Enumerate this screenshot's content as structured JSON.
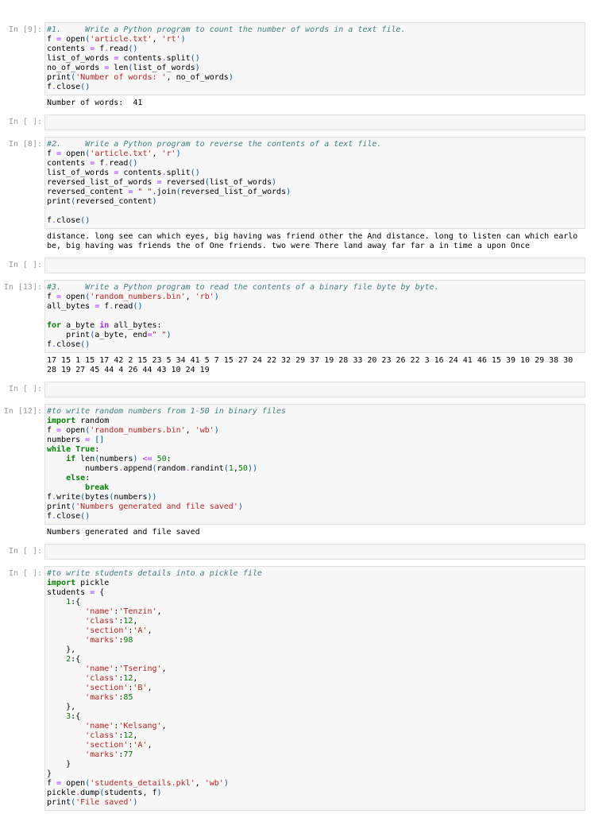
{
  "cells": [
    {
      "prompt": "In [9]:",
      "code": [
        "#1.     Write a Python program to count the number of words in a text file.",
        "f = open('article.txt', 'rt')",
        "contents = f.read()",
        "list_of_words = contents.split()",
        "no_of_words = len(list_of_words)",
        "print('Number of words: ', no_of_words)",
        "f.close()"
      ],
      "output": [
        "Number of words:  41"
      ]
    },
    {
      "prompt": "In [ ]:",
      "code": [
        ""
      ],
      "output": []
    },
    {
      "prompt": "In [8]:",
      "code": [
        "#2.     Write a Python program to reverse the contents of a text file.",
        "f = open('article.txt', 'r')",
        "contents = f.read()",
        "list_of_words = contents.split()",
        "reversed_list_of_words = reversed(list_of_words)",
        "reversed_content = \" \".join(reversed_list_of_words)",
        "print(reversed_content)",
        "",
        "f.close()"
      ],
      "output": [
        "distance. long see can which eyes, big having was friend other the And distance. long to listen can which earlo",
        "be, big having was friends the of One friends. two were There land away far far a in time a upon Once"
      ]
    },
    {
      "prompt": "In [ ]:",
      "code": [
        ""
      ],
      "output": []
    },
    {
      "prompt": "In [13]:",
      "code": [
        "#3.     Write a Python program to read the contents of a binary file byte by byte.",
        "f = open('random_numbers.bin', 'rb')",
        "all_bytes = f.read()",
        "",
        "for a_byte in all_bytes:",
        "    print(a_byte, end=\" \")",
        "f.close()"
      ],
      "output": [
        "17 15 1 15 17 42 2 15 23 5 34 41 5 7 15 27 24 22 32 29 37 19 28 33 20 23 26 22 3 16 24 41 46 15 39 10 29 38 30",
        "28 19 27 45 44 4 26 44 43 10 24 19"
      ]
    },
    {
      "prompt": "In [ ]:",
      "code": [
        ""
      ],
      "output": []
    },
    {
      "prompt": "In [12]:",
      "code": [
        "#to write random numbers from 1-50 in binary files",
        "import random",
        "f = open('random_numbers.bin', 'wb')",
        "numbers = []",
        "while True:",
        "    if len(numbers) <= 50:",
        "        numbers.append(random.randint(1,50))",
        "    else:",
        "        break",
        "f.write(bytes(numbers))",
        "print('Numbers generated and file saved')",
        "f.close()"
      ],
      "output": [
        "Numbers generated and file saved"
      ]
    },
    {
      "prompt": "In [ ]:",
      "code": [
        ""
      ],
      "output": []
    },
    {
      "prompt": "In [ ]:",
      "code": [
        "#to write students details into a pickle file",
        "import pickle",
        "students = {",
        "    1:{",
        "        'name':'Tenzin',",
        "        'class':12,",
        "        'section':'A',",
        "        'marks':98",
        "    },",
        "    2:{",
        "        'name':'Tsering',",
        "        'class':12,",
        "        'section':'B',",
        "        'marks':85",
        "    },",
        "    3:{",
        "        'name':'Kelsang',",
        "        'class':12,",
        "        'section':'A',",
        "        'marks':77",
        "    }",
        "}",
        "f = open('students_details.pkl', 'wb')",
        "pickle.dump(students, f)",
        "print('File saved')"
      ],
      "output": []
    }
  ]
}
